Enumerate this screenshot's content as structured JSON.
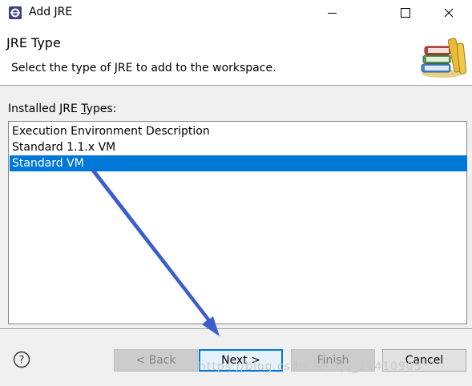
{
  "window": {
    "title": "Add JRE",
    "minimize_symbol": "—",
    "close_symbol": "✕"
  },
  "header": {
    "page_title": "JRE Type",
    "description": "Select the type of JRE to add to the workspace."
  },
  "list": {
    "label_before": "Installed JRE ",
    "label_mnemonic": "T",
    "label_after": "ypes:",
    "items": [
      {
        "label": "Execution Environment Description",
        "selected": false
      },
      {
        "label": "Standard 1.1.x VM",
        "selected": false
      },
      {
        "label": "Standard VM",
        "selected": true
      }
    ]
  },
  "footer": {
    "help_symbol": "?",
    "back_label": "< Back",
    "next_label": "Next >",
    "finish_label": "Finish",
    "cancel_label": "Cancel"
  },
  "watermark": "https://blog.csdn.net/qq_29410905",
  "colors": {
    "selection": "#0078d7",
    "annotation_arrow": "#3a5fcd"
  },
  "icons": [
    "eclipse-app-icon",
    "minimize-icon",
    "maximize-icon",
    "close-icon",
    "books-banner-icon",
    "help-icon"
  ]
}
